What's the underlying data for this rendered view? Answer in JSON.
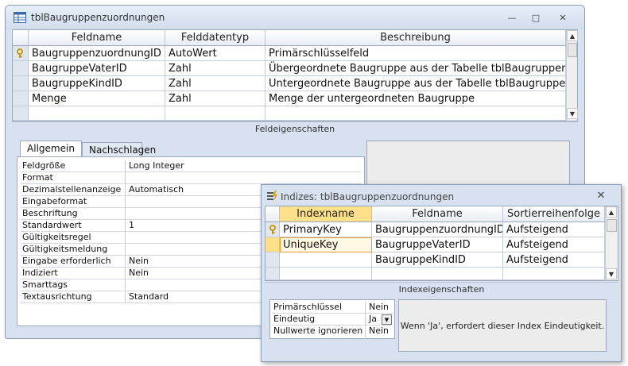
{
  "main_window": {
    "title": "tblBaugruppenzuordnungen",
    "controls": {
      "minimize": "—",
      "maximize": "□",
      "close": "✕"
    }
  },
  "field_grid": {
    "columns": [
      "Feldname",
      "Felddatentyp",
      "Beschreibung"
    ],
    "rows": [
      {
        "name": "BaugruppenzuordnungID",
        "type": "AutoWert",
        "description": "Primärschlüsselfeld",
        "primary_key": true
      },
      {
        "name": "BaugruppeVaterID",
        "type": "Zahl",
        "description": "Übergeordnete Baugruppe aus der Tabelle tblBaugruppen",
        "primary_key": false
      },
      {
        "name": "BaugruppeKindID",
        "type": "Zahl",
        "description": "Untergeordnete Baugruppe aus der Tabelle tblBaugruppen",
        "primary_key": false
      },
      {
        "name": "Menge",
        "type": "Zahl",
        "description": "Menge der untergeordneten Baugruppe",
        "primary_key": false
      },
      {
        "name": "",
        "type": "",
        "description": "",
        "primary_key": false
      }
    ]
  },
  "field_props_label": "Feldeigenschaften",
  "props_tabs": [
    "Allgemein",
    "Nachschlagen"
  ],
  "properties": [
    {
      "label": "Feldgröße",
      "value": "Long Integer"
    },
    {
      "label": "Format",
      "value": ""
    },
    {
      "label": "Dezimalstellenanzeige",
      "value": "Automatisch"
    },
    {
      "label": "Eingabeformat",
      "value": ""
    },
    {
      "label": "Beschriftung",
      "value": ""
    },
    {
      "label": "Standardwert",
      "value": "1"
    },
    {
      "label": "Gültigkeitsregel",
      "value": ""
    },
    {
      "label": "Gültigkeitsmeldung",
      "value": ""
    },
    {
      "label": "Eingabe erforderlich",
      "value": "Nein"
    },
    {
      "label": "Indiziert",
      "value": "Nein"
    },
    {
      "label": "Smarttags",
      "value": ""
    },
    {
      "label": "Textausrichtung",
      "value": "Standard"
    }
  ],
  "index_window": {
    "title": "Indizes: tblBaugruppenzuordnungen",
    "close": "✕",
    "columns": [
      "Indexname",
      "Feldname",
      "Sortierreihenfolge"
    ],
    "rows": [
      {
        "index": "PrimaryKey",
        "field": "BaugruppenzuordnungID",
        "order": "Aufsteigend",
        "primary_key": true
      },
      {
        "index": "UniqueKey",
        "field": "BaugruppeVaterID",
        "order": "Aufsteigend",
        "primary_key": false
      },
      {
        "index": "",
        "field": "BaugruppeKindID",
        "order": "Aufsteigend",
        "primary_key": false
      },
      {
        "index": "",
        "field": "",
        "order": "",
        "primary_key": false
      }
    ],
    "props_label": "Indexeigenschaften",
    "properties": [
      {
        "label": "Primärschlüssel",
        "value": "Nein"
      },
      {
        "label": "Eindeutig",
        "value": "Ja"
      },
      {
        "label": "Nullwerte ignorieren",
        "value": "Nein"
      }
    ],
    "help_text": "Wenn 'Ja', erfordert dieser Index Eindeutigkeit."
  },
  "icons": {
    "table": "table-icon",
    "key": "key-icon",
    "index": "lightning-index-icon"
  },
  "colors": {
    "window_bg": "#d7e1ef",
    "header_selected": "#ffe08a",
    "key": "#d4a017"
  }
}
